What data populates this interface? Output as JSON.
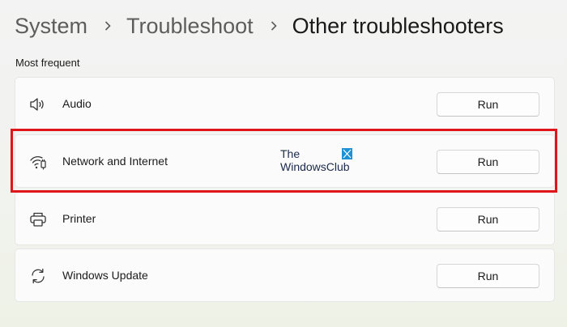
{
  "breadcrumb": {
    "items": [
      "System",
      "Troubleshoot",
      "Other troubleshooters"
    ]
  },
  "section": {
    "label": "Most frequent"
  },
  "troubleshooters": [
    {
      "label": "Audio",
      "icon": "speaker-icon",
      "button": "Run"
    },
    {
      "label": "Network and Internet",
      "icon": "wifi-icon",
      "button": "Run"
    },
    {
      "label": "Printer",
      "icon": "printer-icon",
      "button": "Run"
    },
    {
      "label": "Windows Update",
      "icon": "sync-icon",
      "button": "Run"
    }
  ],
  "watermark": {
    "line1": "The",
    "line2": "WindowsClub"
  },
  "colors": {
    "highlight": "#e0141b",
    "watermark_logo": "#1e90d6"
  }
}
